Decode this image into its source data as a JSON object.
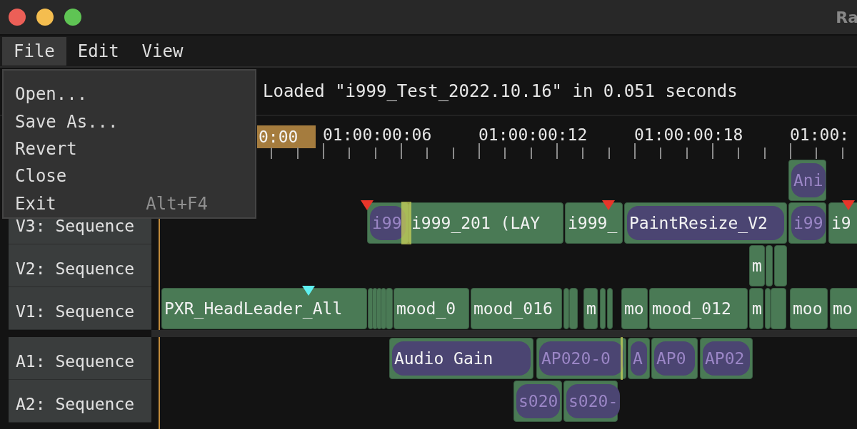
{
  "window": {
    "title": "Ra"
  },
  "menubar": [
    {
      "label": "File",
      "selected": true
    },
    {
      "label": "Edit",
      "selected": false
    },
    {
      "label": "View",
      "selected": false
    }
  ],
  "menu": {
    "items": [
      {
        "label": "Open..."
      },
      {
        "label": "Save As..."
      },
      {
        "label": "Revert"
      },
      {
        "label": "Close"
      },
      {
        "label": "Exit",
        "shortcut": "Alt+F4"
      }
    ]
  },
  "toolbar": {
    "status": "Loaded \"i999_Test_2022.10.16\" in 0.051 seconds"
  },
  "timeline": {
    "playhead": "0:00",
    "ruler": [
      "01:00:00:06",
      "01:00:00:12",
      "01:00:00:18",
      "01:00:"
    ]
  },
  "tracks": [
    {
      "clips": [
        {
          "kind": "dim",
          "label": "Ani"
        }
      ]
    },
    {
      "name": "V3: Sequence",
      "clips": [
        {
          "kind": "dim",
          "label": "i99",
          "marker": {
            "color": "#e8362a"
          }
        },
        {
          "kind": "clip",
          "label": "i999_201 (LAY",
          "transition": true
        },
        {
          "kind": "clip",
          "label": "i999_",
          "marker": {
            "color": "#e8362a"
          }
        },
        {
          "kind": "effect",
          "label": "PaintResize_V2"
        },
        {
          "kind": "dim",
          "label": "i99"
        },
        {
          "kind": "clip",
          "label": "i9",
          "marker": {
            "color": "#e8362a"
          }
        }
      ]
    },
    {
      "name": "V2: Sequence",
      "clips": [
        {
          "kind": "clip",
          "label": "m"
        },
        {
          "kind": "clip"
        },
        {
          "kind": "clip"
        }
      ]
    },
    {
      "name": "V1: Sequence",
      "clips": [
        {
          "kind": "clip",
          "label": "PXR_HeadLeader_All",
          "marker": {
            "color": "#5ff0f0"
          }
        },
        {
          "kind": "clip"
        },
        {
          "kind": "clip"
        },
        {
          "kind": "clip"
        },
        {
          "kind": "clip"
        },
        {
          "kind": "clip"
        },
        {
          "kind": "clip",
          "label": "mood_0"
        },
        {
          "kind": "clip",
          "label": "mood_016"
        },
        {
          "kind": "clip"
        },
        {
          "kind": "clip"
        },
        {
          "kind": "clip",
          "label": "m"
        },
        {
          "kind": "clip"
        },
        {
          "kind": "clip"
        },
        {
          "kind": "clip",
          "label": "mo"
        },
        {
          "kind": "clip",
          "label": "mood_012"
        },
        {
          "kind": "clip",
          "label": "m"
        },
        {
          "kind": "clip"
        },
        {
          "kind": "clip"
        },
        {
          "kind": "clip",
          "label": "moo"
        },
        {
          "kind": "clip",
          "label": "mo"
        }
      ]
    },
    {
      "name": "A1: Sequence",
      "clips": [
        {
          "kind": "effect",
          "label": "Audio Gain"
        },
        {
          "kind": "dim",
          "label": "AP020-0"
        },
        {
          "kind": "dim",
          "label": "A",
          "transition": true
        },
        {
          "kind": "dim",
          "label": "AP0"
        },
        {
          "kind": "dim",
          "label": "AP02"
        }
      ]
    },
    {
      "name": "A2: Sequence",
      "clips": [
        {
          "kind": "dim",
          "label": "s020"
        },
        {
          "kind": "dim",
          "label": "s020-"
        }
      ]
    }
  ]
}
